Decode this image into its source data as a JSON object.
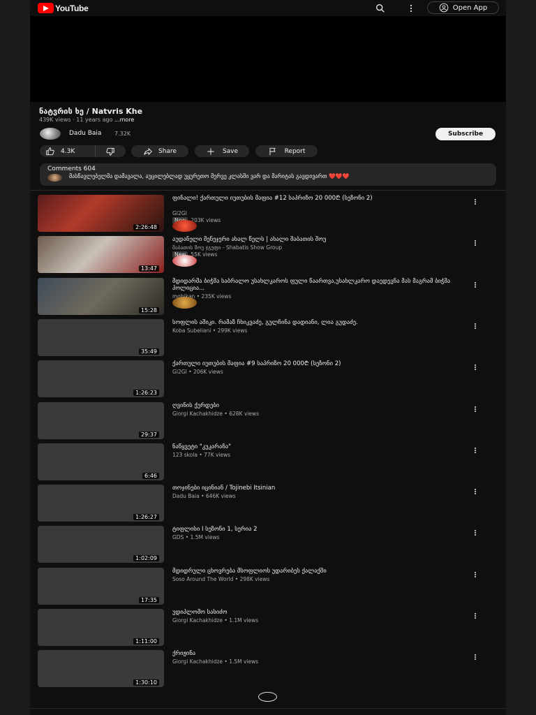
{
  "header": {
    "logo_text": "YouTube",
    "open_app_label": "Open App",
    "search_icon": "search-icon",
    "more_icon": "more-vert-icon"
  },
  "video": {
    "title": "ნატვრის ხე / Natvris Khe",
    "views": "439K views",
    "age": "11 years ago",
    "more_label": "...more",
    "channel": "Dadu Baia",
    "subscribers": "7.32K",
    "subscribe_label": "Subscribe"
  },
  "actions": {
    "likes": "4.3K",
    "share_label": "Share",
    "save_label": "Save",
    "report_label": "Report"
  },
  "comments": {
    "label": "Comments 604",
    "top_comment": "მასწავლებელმა დამავალა, აუცილებლად უყურეთო მერვე კლასში ვარ და მარიტას გავდივართ ❤️❤️❤️"
  },
  "colors": {
    "brand": "#ff0000",
    "background": "#0f0f0f",
    "pill": "#272727"
  },
  "videos": [
    {
      "title": "ფინალი! ქართული იუთუბის მაფია #12 საპრიზო 20 000₾ (სეზონი 2)",
      "channel": "GI2GI",
      "badge": "New",
      "views": "203K views",
      "duration": "2:26:48"
    },
    {
      "title": "აუდანელი მენეჯერი ახალ წელს | ახალი შაბათის შოუ",
      "channel": "შაბათის შოუ ჯგუფი - Shabatis Show Group",
      "badge": "New",
      "views": "55K views",
      "duration": "13:47"
    },
    {
      "title": "მდიდარმა ბიჭმა საბრალო უსახლკაროს ფული წაართვა,უსახლკარო დაედევნა მას მაგრამ ბიჭმა პოლიცია...",
      "channel": "mohikan",
      "badge": "",
      "views": "235K views",
      "duration": "15:28"
    },
    {
      "title": "სოფლის აშიკი. რამაზ ჩხიკვაძე, გულჩინა დადიანი, ლია გუდაძე.",
      "channel": "Koba Subeliani",
      "badge": "",
      "views": "299K views",
      "duration": "35:49"
    },
    {
      "title": "ქართული იუთუბის მაფია #9 საპრიზო 20 000₾ (სეზონი 2)",
      "channel": "GI2GI",
      "badge": "",
      "views": "206K views",
      "duration": "1:26:23"
    },
    {
      "title": "ღვინის ქურდები",
      "channel": "Giorgi Kachakhidze",
      "badge": "",
      "views": "628K views",
      "duration": "29:37"
    },
    {
      "title": "ნაწყვეტი \"კუკარაჩა\"",
      "channel": "123 skola",
      "badge": "",
      "views": "77K views",
      "duration": "6:46"
    },
    {
      "title": "თოჯინები იცინიან / Tojinebi Itsinian",
      "channel": "Dadu Baia",
      "badge": "",
      "views": "646K views",
      "duration": "1:26:27"
    },
    {
      "title": "ტიფლისი I სეზონი 1, სერია 2",
      "channel": "GDS",
      "badge": "",
      "views": "1.5M views",
      "duration": "1:02:09"
    },
    {
      "title": "მდიდრული ცხოვრება მსოფლიოს უდარიბეს ქალაქში",
      "channel": "Soso Around The World",
      "badge": "",
      "views": "298K views",
      "duration": "17:35"
    },
    {
      "title": "უდიპლომო სასიძო",
      "channel": "Giorgi Kachakhidze",
      "badge": "",
      "views": "1.1M views",
      "duration": "1:11:00"
    },
    {
      "title": "ქრიჟინა",
      "channel": "Giorgi Kachakhidze",
      "badge": "",
      "views": "1.5M views",
      "duration": "1:30:10"
    }
  ]
}
